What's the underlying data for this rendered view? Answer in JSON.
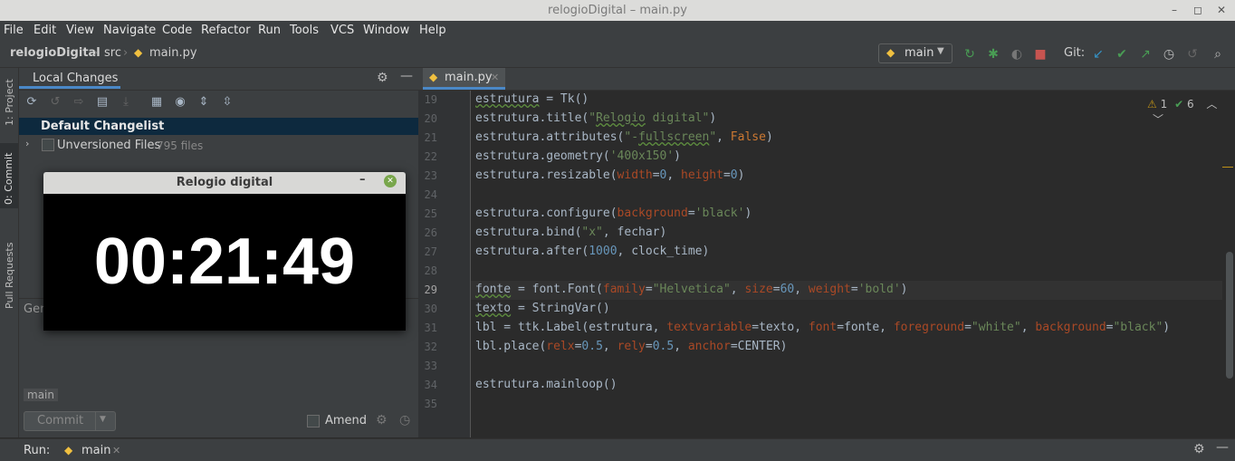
{
  "window": {
    "title": "relogioDigital – main.py"
  },
  "menu": [
    "File",
    "Edit",
    "View",
    "Navigate",
    "Code",
    "Refactor",
    "Run",
    "Tools",
    "VCS",
    "Window",
    "Help"
  ],
  "breadcrumb": {
    "project": "relogioDigital",
    "folder": "src",
    "file": "main.py"
  },
  "run_config": {
    "name": "main"
  },
  "git": {
    "label": "Git:"
  },
  "left_tabs": {
    "project": "1: Project",
    "commit": "0: Commit",
    "pull": "Pull Requests"
  },
  "local_changes": {
    "title": "Local Changes",
    "changelist": "Default Changelist",
    "unversioned": "Unversioned Files",
    "unversioned_count": "795 files",
    "hidden_text": "Ger",
    "branch": "main",
    "commit_label": "Commit",
    "amend_label": "Amend"
  },
  "editor": {
    "tab": "main.py",
    "warnings": "1",
    "checks": "6",
    "first_line": 19,
    "current_line": 29
  },
  "clock": {
    "title": "Relogio digital",
    "time": "00:21:49"
  },
  "runbar": {
    "label": "Run:",
    "config": "main"
  },
  "colors": {
    "accent": "#3592c4",
    "changelist_bg": "#0d293e",
    "run_green": "#499c54",
    "stop_red": "#c75450"
  }
}
